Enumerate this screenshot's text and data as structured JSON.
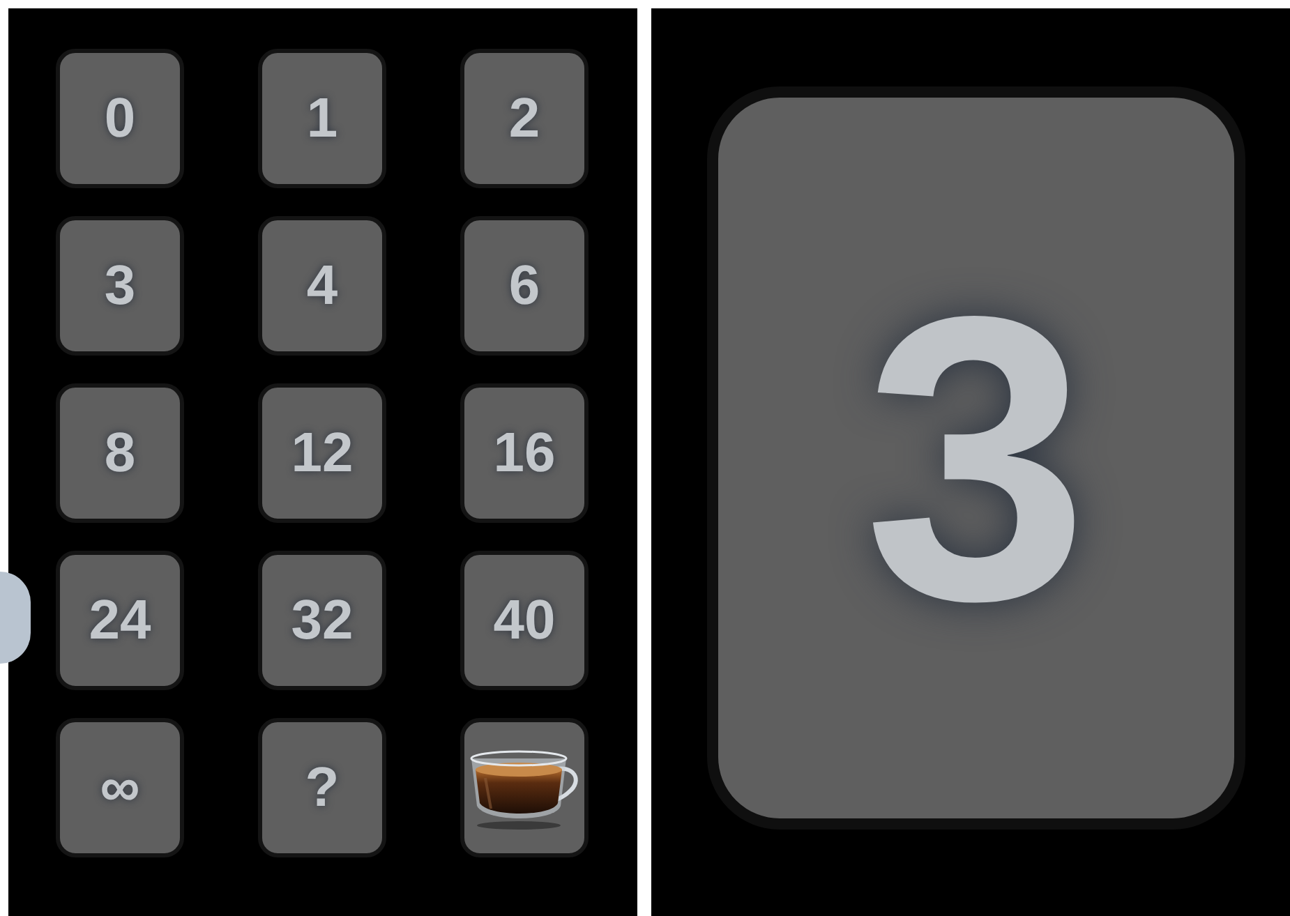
{
  "deck": {
    "cards": [
      {
        "kind": "value",
        "label": "0"
      },
      {
        "kind": "value",
        "label": "1"
      },
      {
        "kind": "value",
        "label": "2"
      },
      {
        "kind": "value",
        "label": "3"
      },
      {
        "kind": "value",
        "label": "4"
      },
      {
        "kind": "value",
        "label": "6"
      },
      {
        "kind": "value",
        "label": "8"
      },
      {
        "kind": "value",
        "label": "12"
      },
      {
        "kind": "value",
        "label": "16"
      },
      {
        "kind": "value",
        "label": "24"
      },
      {
        "kind": "value",
        "label": "32"
      },
      {
        "kind": "value",
        "label": "40"
      },
      {
        "kind": "value",
        "label": "∞"
      },
      {
        "kind": "value",
        "label": "?"
      },
      {
        "kind": "coffee"
      }
    ]
  },
  "chosen_card": {
    "label": "3"
  }
}
